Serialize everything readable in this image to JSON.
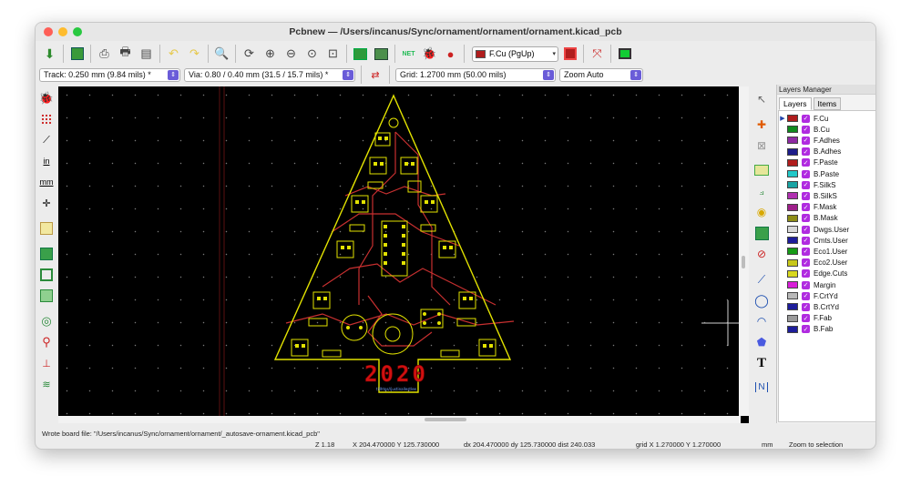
{
  "window": {
    "title": "Pcbnew — /Users/incanus/Sync/ornament/ornament/ornament.kicad_pcb"
  },
  "toolbar": {
    "active_layer": {
      "label": "F.Cu (PgUp)",
      "color": "#b01d1d"
    }
  },
  "options_bar": {
    "track": "Track: 0.250 mm (9.84 mils) *",
    "via": "Via: 0.80 / 0.40 mm (31.5 / 15.7 mils) *",
    "grid": "Grid: 1.2700 mm (50.00 mils)",
    "zoom": "Zoom Auto"
  },
  "left_tools": {
    "inch_label": "in",
    "mm_label": "mm"
  },
  "right_tools": {
    "text_tool": "T",
    "dimension_tool": "N"
  },
  "pcb": {
    "silk_text": "2020",
    "credit_text": "tillhtos//justinallestlee",
    "silk_color": "#d01010",
    "outline_color": "#e2e200",
    "copper_color": "#cc3333",
    "pad_color": "#e2e200"
  },
  "layers_manager": {
    "title": "Layers Manager",
    "tabs": [
      "Layers",
      "Items"
    ],
    "layers": [
      {
        "name": "F.Cu",
        "color": "#b01d1d",
        "active": true
      },
      {
        "name": "B.Cu",
        "color": "#0f8a1e"
      },
      {
        "name": "F.Adhes",
        "color": "#8e2aa3"
      },
      {
        "name": "B.Adhes",
        "color": "#1d1d8a"
      },
      {
        "name": "F.Paste",
        "color": "#b01d1d"
      },
      {
        "name": "B.Paste",
        "color": "#22c8c8"
      },
      {
        "name": "F.SilkS",
        "color": "#1aa3a3"
      },
      {
        "name": "B.SilkS",
        "color": "#b030b0"
      },
      {
        "name": "F.Mask",
        "color": "#9e1f8a"
      },
      {
        "name": "B.Mask",
        "color": "#8d8d16"
      },
      {
        "name": "Dwgs.User",
        "color": "#d8d8d8"
      },
      {
        "name": "Cmts.User",
        "color": "#1d1d9a"
      },
      {
        "name": "Eco1.User",
        "color": "#169b16"
      },
      {
        "name": "Eco2.User",
        "color": "#c8c81a"
      },
      {
        "name": "Edge.Cuts",
        "color": "#d8d81e"
      },
      {
        "name": "Margin",
        "color": "#d81ed8"
      },
      {
        "name": "F.CrtYd",
        "color": "#b8b8b8"
      },
      {
        "name": "B.CrtYd",
        "color": "#1d1d9a"
      },
      {
        "name": "F.Fab",
        "color": "#9a9a9a"
      },
      {
        "name": "B.Fab",
        "color": "#1d1d9a"
      }
    ]
  },
  "status": {
    "message": "Wrote board file: \"/Users/incanus/Sync/ornament/ornament/_autosave-ornament.kicad_pcb\"",
    "zoom": "Z 1.18",
    "abs_coords": "X 204.470000  Y 125.730000",
    "rel_coords": "dx 204.470000  dy 125.730000  dist 240.033",
    "grid": "grid X 1.270000  Y 1.270000",
    "units": "mm",
    "action": "Zoom to selection"
  }
}
